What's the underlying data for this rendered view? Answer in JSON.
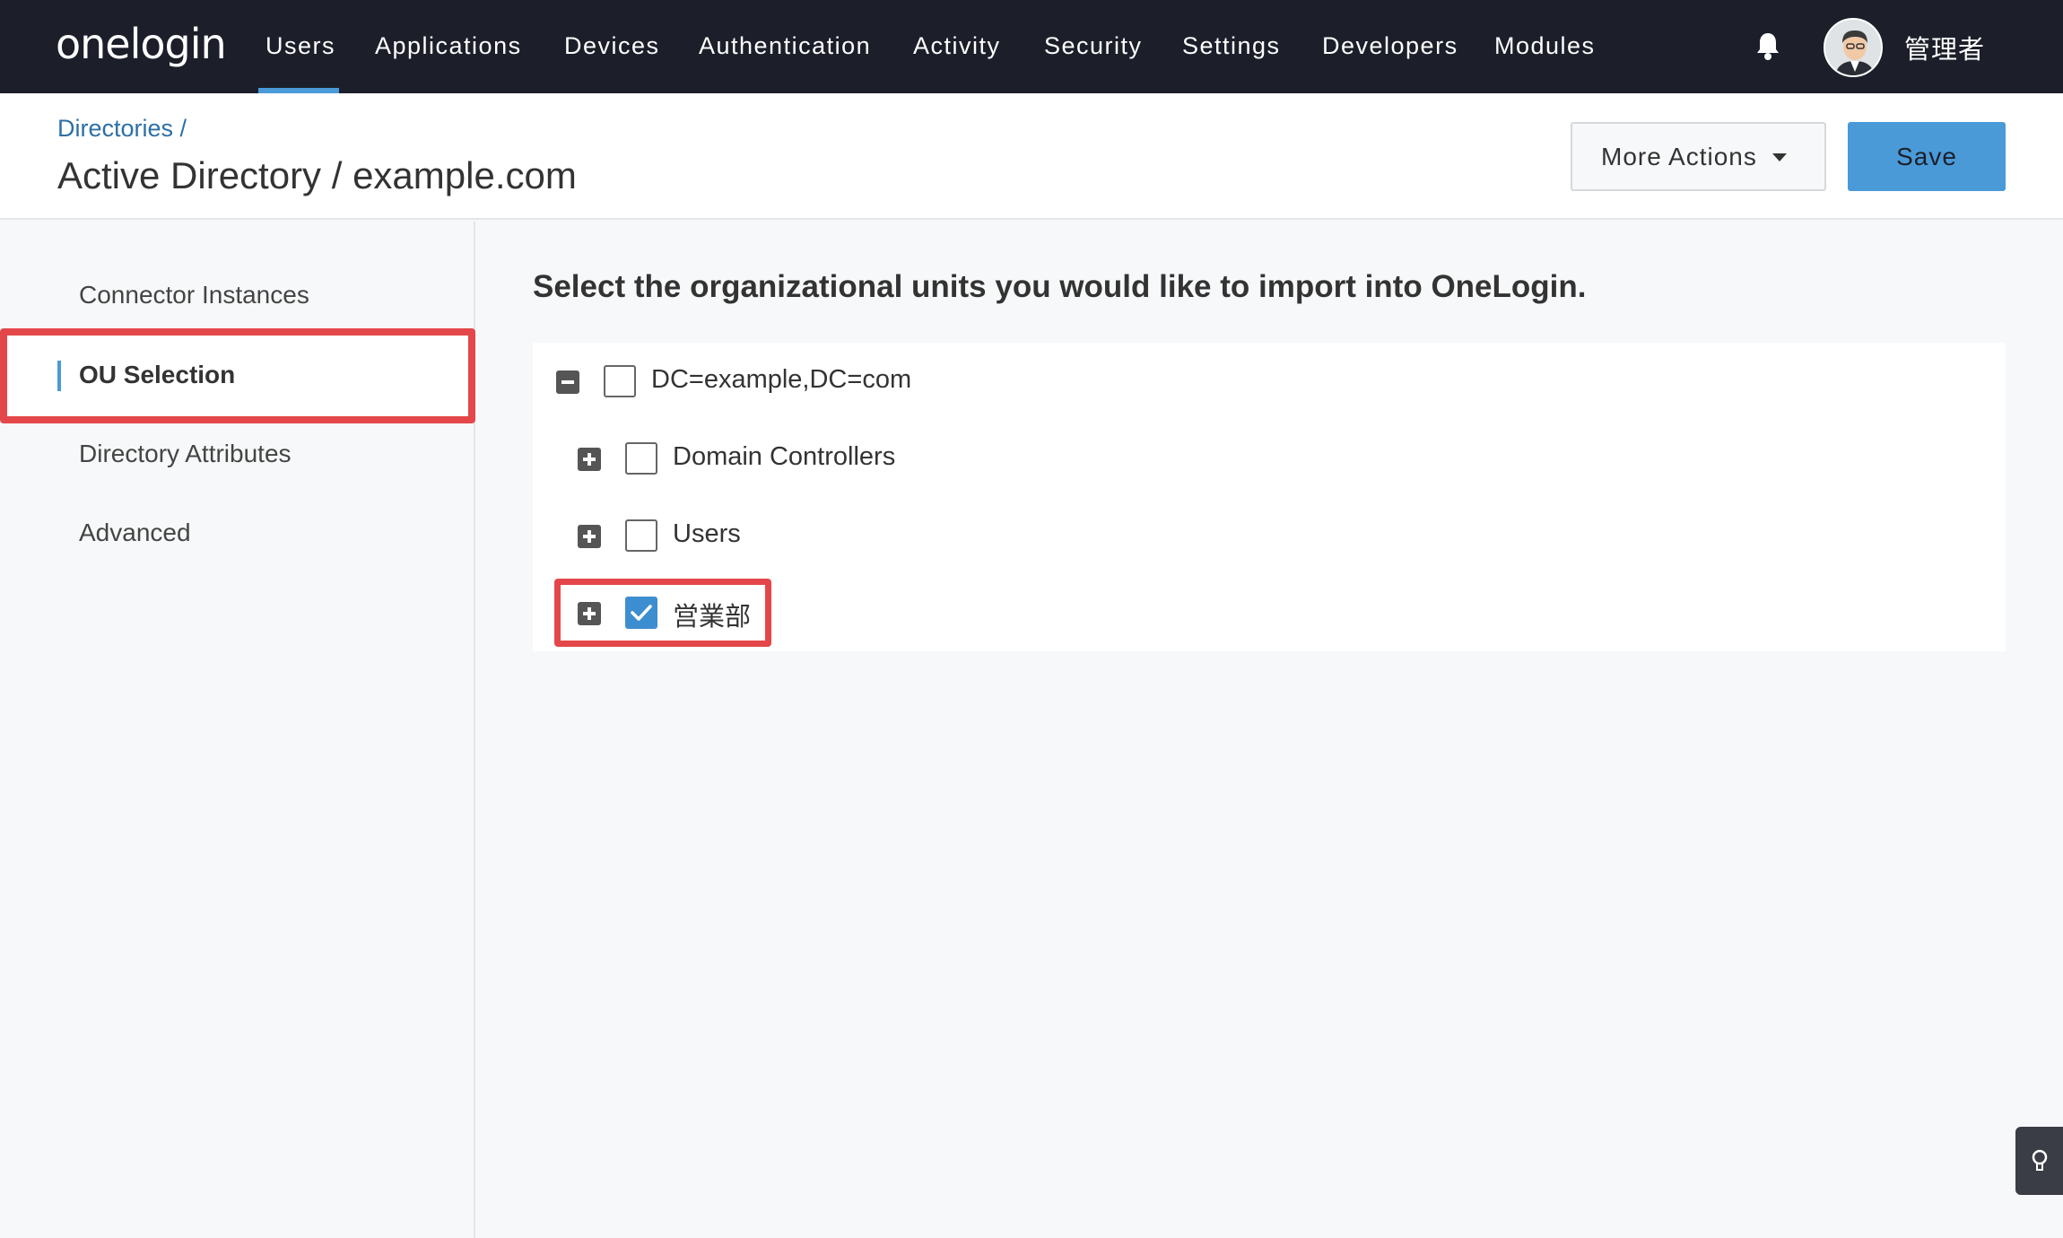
{
  "brand": {
    "logo_text": "onelogin"
  },
  "nav": {
    "items": [
      {
        "label": "Users"
      },
      {
        "label": "Applications"
      },
      {
        "label": "Devices"
      },
      {
        "label": "Authentication"
      },
      {
        "label": "Activity"
      },
      {
        "label": "Security"
      },
      {
        "label": "Settings"
      },
      {
        "label": "Developers"
      },
      {
        "label": "Modules"
      }
    ],
    "active": "Users"
  },
  "user": {
    "name": "管理者"
  },
  "header": {
    "breadcrumb": "Directories /",
    "title": "Active Directory / example.com",
    "more_actions_label": "More Actions",
    "save_label": "Save"
  },
  "sidebar": {
    "items": [
      {
        "label": "Connector Instances"
      },
      {
        "label": "OU Selection"
      },
      {
        "label": "Directory Attributes"
      },
      {
        "label": "Advanced"
      }
    ],
    "active": "OU Selection"
  },
  "main": {
    "heading": "Select the organizational units you would like to import into OneLogin.",
    "tree": [
      {
        "label": "DC=example,DC=com",
        "expanded": true,
        "checked": false
      },
      {
        "label": "Domain Controllers",
        "expanded": false,
        "checked": false
      },
      {
        "label": "Users",
        "expanded": false,
        "checked": false
      },
      {
        "label": "営業部",
        "expanded": false,
        "checked": true
      }
    ]
  },
  "colors": {
    "nav_bg": "#1c1f2a",
    "accent": "#4a9ad8",
    "highlight": "#e4474a",
    "link": "#2d6fa6"
  },
  "icons": [
    "bell-icon",
    "avatar",
    "caret-down-icon",
    "collapse-icon",
    "expand-icon",
    "checkmark-icon",
    "lightbulb-icon"
  ]
}
